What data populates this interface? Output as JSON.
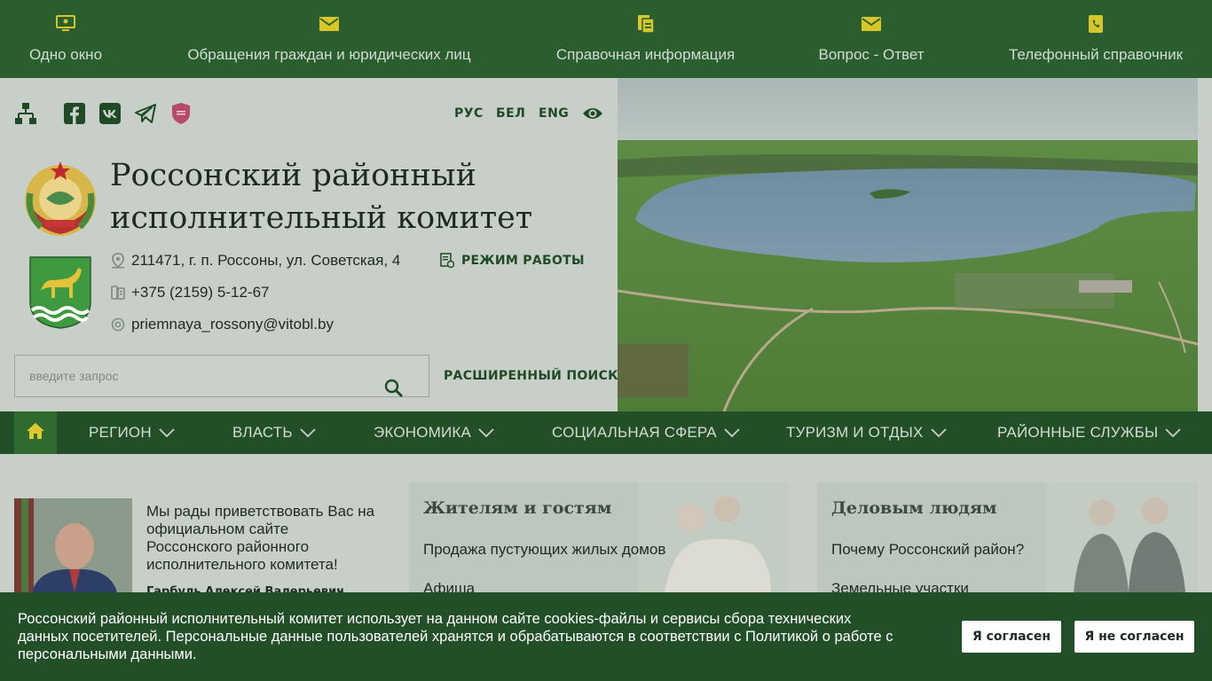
{
  "topbar": {
    "items": [
      {
        "label": "Одно окно",
        "icon": "monitor-icon"
      },
      {
        "label": "Обращения граждан и юридических лиц",
        "icon": "mail-icon"
      },
      {
        "label": "Справочная информация",
        "icon": "document-icon"
      },
      {
        "label": "Вопрос - Ответ",
        "icon": "mail-icon"
      },
      {
        "label": "Телефонный справочник",
        "icon": "phone-book-icon"
      }
    ],
    "icon_color": "#d7c62a"
  },
  "header": {
    "languages": [
      "РУС",
      "БЕЛ",
      "ENG"
    ],
    "title_line1": "Россонский районный",
    "title_line2": "исполнительный комитет",
    "address": "211471, г. п. Россоны, ул. Советская, 4",
    "phone": "+375 (2159) 5-12-67",
    "email": "priemnaya_rossony@vitobl.by",
    "work_mode": "РЕЖИМ РАБОТЫ",
    "search_placeholder": "введите запрос",
    "advanced_search": "РАСШИРЕННЫЙ ПОИСК"
  },
  "nav": {
    "items": [
      "РЕГИОН",
      "ВЛАСТЬ",
      "ЭКОНОМИКА",
      "СОЦИАЛЬНАЯ СФЕРА",
      "ТУРИЗМ И ОТДЫХ",
      "РАЙОННЫЕ СЛУЖБЫ"
    ]
  },
  "welcome": {
    "text": "Мы рады приветствовать Вас на официальном сайте Россонского районного исполнительного комитета!",
    "name": "Гарбуль Алексей Валерьевич"
  },
  "cards": [
    {
      "title": "Жителям и гостям",
      "links": [
        "Продажа пустующих жилых домов",
        "Афиша"
      ]
    },
    {
      "title": "Деловым людям",
      "links": [
        "Почему Россонский район?",
        "Земельные участки"
      ]
    }
  ],
  "cookie": {
    "text": "Россонский районный исполнительный комитет использует на данном сайте cookies-файлы и сервисы сбора технических данных посетителей. Персональные данные пользователей хранятся и обрабатываются в соответствии с Политикой о работе с персональными данными.",
    "accept": "Я согласен",
    "decline": "Я не согласен"
  },
  "colors": {
    "topbar": "#2b5e2f",
    "nav": "#234f28",
    "accent": "#1f4a25",
    "page": "#c7cfc8"
  }
}
